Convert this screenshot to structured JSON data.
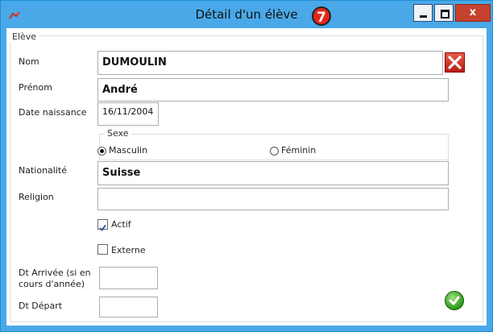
{
  "window": {
    "title": "Détail d'un élève",
    "badge": "7",
    "close_label": "x"
  },
  "group": {
    "title": "Elève"
  },
  "fields": {
    "nom_label": "Nom",
    "nom_value": "DUMOULIN",
    "prenom_label": "Prénom",
    "prenom_value": "André",
    "date_label": "Date naissance",
    "date_value": "16/11/2004",
    "nationalite_label": "Nationalité",
    "nationalite_value": "Suisse",
    "religion_label": "Religion",
    "religion_value": "",
    "arrivee_label": "Dt Arrivée (si en cours d'année)",
    "arrivee_value": "",
    "depart_label": "Dt Départ",
    "depart_value": ""
  },
  "sexe": {
    "title": "Sexe",
    "options": [
      "Masculin",
      "Féminin"
    ],
    "selected": "Masculin"
  },
  "checkboxes": {
    "actif_label": "Actif",
    "actif_checked": true,
    "externe_label": "Externe",
    "externe_checked": false
  },
  "icons": {
    "delete": "red-x-icon",
    "confirm": "green-check-icon"
  }
}
